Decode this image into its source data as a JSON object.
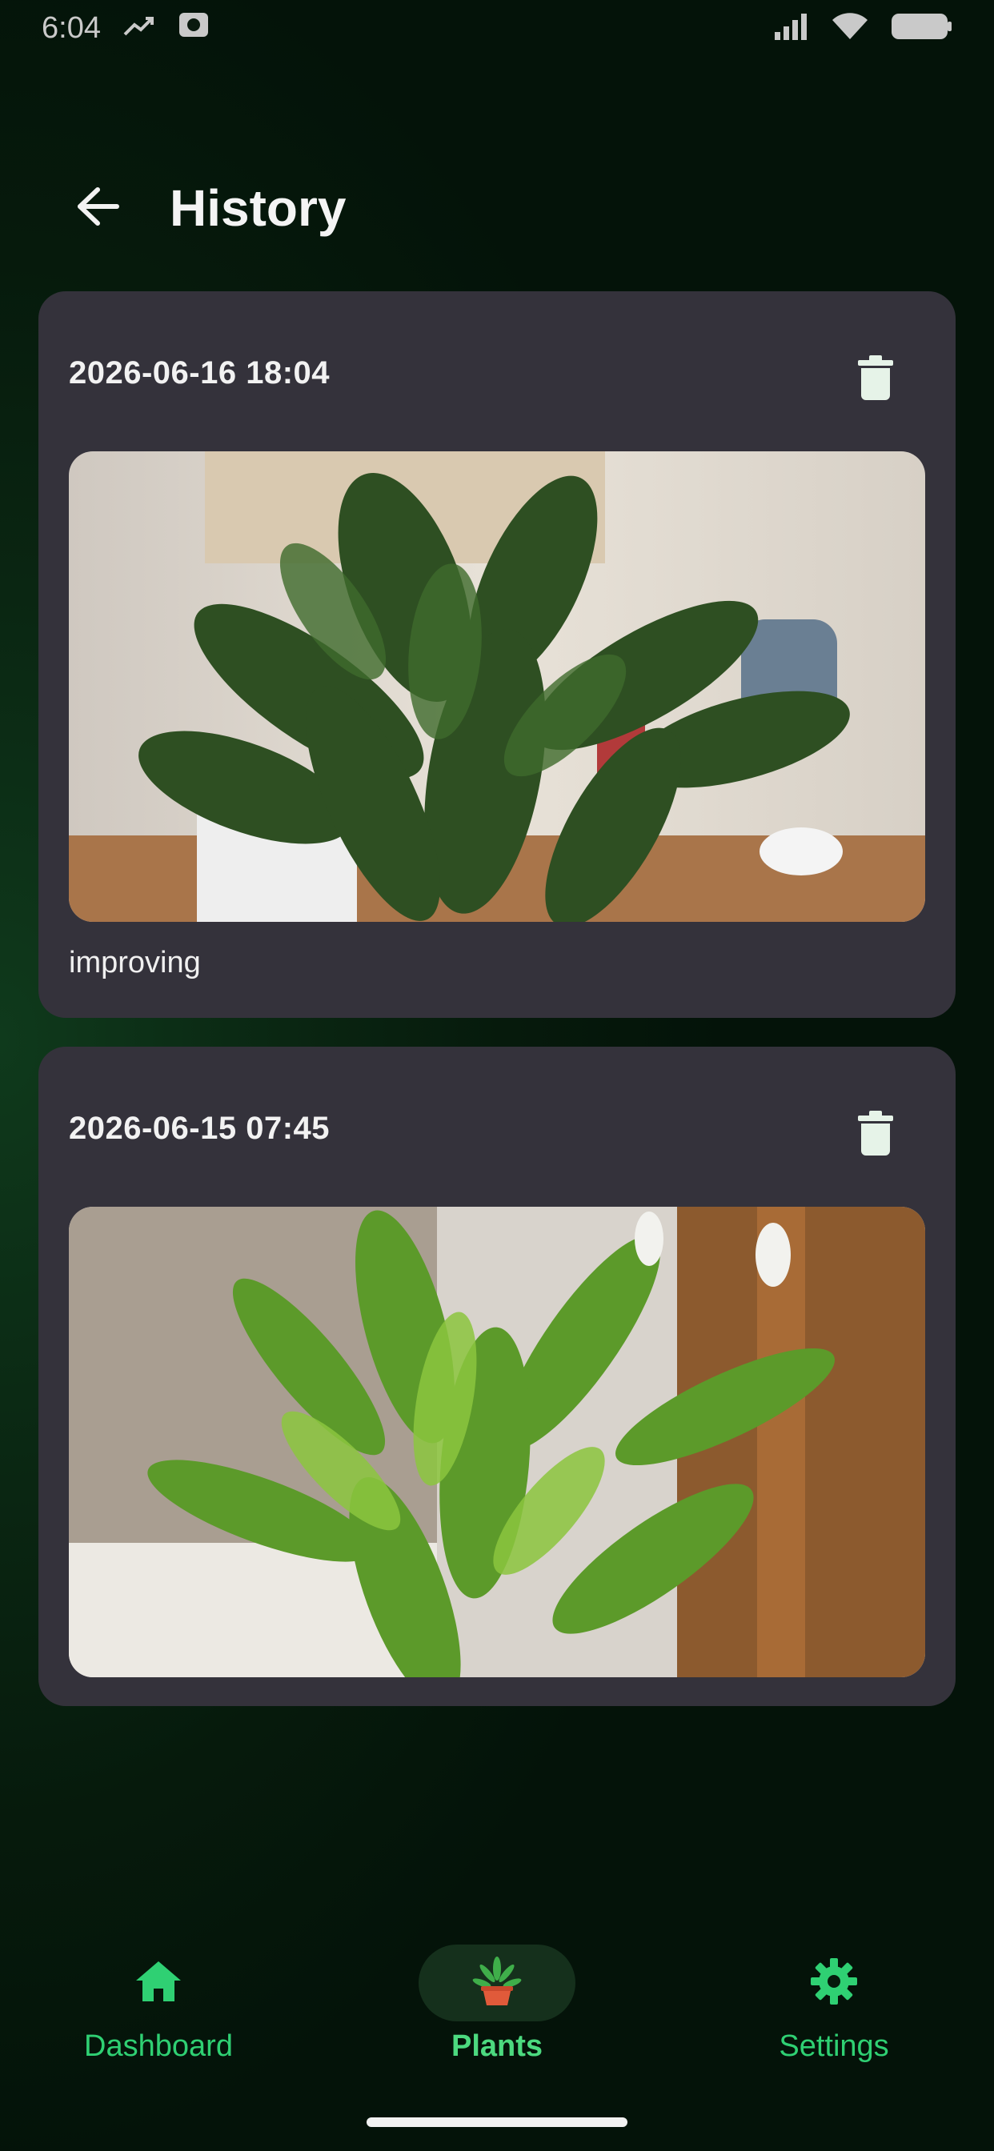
{
  "status_bar": {
    "time": "6:04",
    "icons": [
      "trending-icon",
      "camera-icon",
      "signal-icon",
      "wifi-icon",
      "battery-icon"
    ]
  },
  "header": {
    "title": "History",
    "back_icon": "arrow-left-icon"
  },
  "entries": [
    {
      "date": "2026-06-16 18:04",
      "note": "improving",
      "delete_icon": "trash-icon"
    },
    {
      "date": "2026-06-15 07:45",
      "note": "",
      "delete_icon": "trash-icon"
    }
  ],
  "bottom_nav": {
    "items": [
      {
        "label": "Dashboard",
        "icon": "home-icon",
        "active": false
      },
      {
        "label": "Plants",
        "icon": "potted-plant-icon",
        "active": true
      },
      {
        "label": "Settings",
        "icon": "gear-icon",
        "active": false
      }
    ]
  },
  "colors": {
    "background": "#061a0c",
    "card": "#34323b",
    "accent": "#2fd073",
    "text": "#f2f2f2"
  }
}
